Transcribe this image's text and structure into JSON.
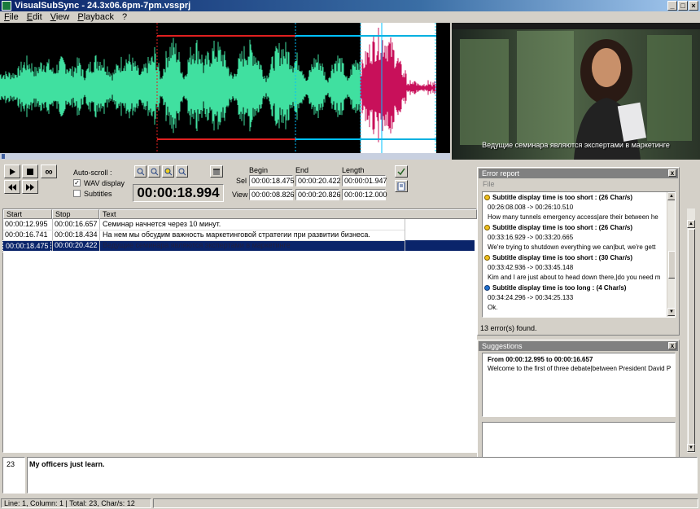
{
  "window": {
    "title": "VisualSubSync - 24.3x06.6pm-7pm.vssprj"
  },
  "menu": [
    "File",
    "Edit",
    "View",
    "Playback",
    "?"
  ],
  "video": {
    "subtitle": "Ведущие семинара являются экспертами в маркетинге"
  },
  "toolbar": {
    "loop_icon": "∞",
    "autoscroll_label": "Auto-scroll :",
    "wav_display_label": "WAV display",
    "wav_display_checked": true,
    "subtitles_label": "Subtitles",
    "subtitles_checked": false,
    "time_display": "00:00:18.994"
  },
  "timing": {
    "begin_label": "Begin",
    "end_label": "End",
    "length_label": "Length",
    "sel_label": "Sel",
    "view_label": "View",
    "sel_begin": "00:00:18.475",
    "sel_end": "00:00:20.422",
    "sel_length": "00:00:01.947",
    "view_begin": "00:00:08.826",
    "view_end": "00:00:20.826",
    "view_length": "00:00:12.000"
  },
  "grid": {
    "headers": [
      "Start",
      "Stop",
      "Text"
    ],
    "rows": [
      {
        "start": "00:00:12.995",
        "stop": "00:00:16.657",
        "text": "Семинар начнется через 10 минут."
      },
      {
        "start": "00:00:16.741",
        "stop": "00:00:18.434",
        "text": "На нем мы обсудим важность маркетинговой стратегии при развитии бизнеса."
      },
      {
        "start": "00:00:18.475",
        "stop": "00:00:20.422",
        "text": "Ведущие семинара являются экспертами в маркетинге"
      }
    ]
  },
  "error_report": {
    "title": "Error report",
    "menu": "File",
    "items": [
      {
        "type": "Subtitle display time is too short : (26 Char/s)",
        "time": "00:26:08.008 -> 00:26:10.510",
        "text": "How many tunnels emergency access|are their between he",
        "color": "#f0c020"
      },
      {
        "type": "Subtitle display time is too short : (26 Char/s)",
        "time": "00:33:16.929 -> 00:33:20.665",
        "text": "We're trying to shutdown everything we can|but, we're gett",
        "color": "#f0c020"
      },
      {
        "type": "Subtitle display time is too short : (30 Char/s)",
        "time": "00:33:42.936 -> 00:33:45.148",
        "text": "Kim and I are just about to head down there,|do you need m",
        "color": "#f0c020"
      },
      {
        "type": "Subtitle display time is too long : (4 Char/s)",
        "time": "00:34:24.296 -> 00:34:25.133",
        "text": "Ok.",
        "color": "#2070d0"
      }
    ],
    "status": "13 error(s) found."
  },
  "suggestions": {
    "title": "Suggestions",
    "heading": "From 00:00:12.995 to 00:00:16.657",
    "text": "Welcome to the first of three debate|between President David P"
  },
  "editor": {
    "line_number": "23",
    "text": "My officers just learn."
  },
  "statusbar": {
    "text": "Line: 1, Column: 1 | Total: 23, Char/s: 12"
  }
}
